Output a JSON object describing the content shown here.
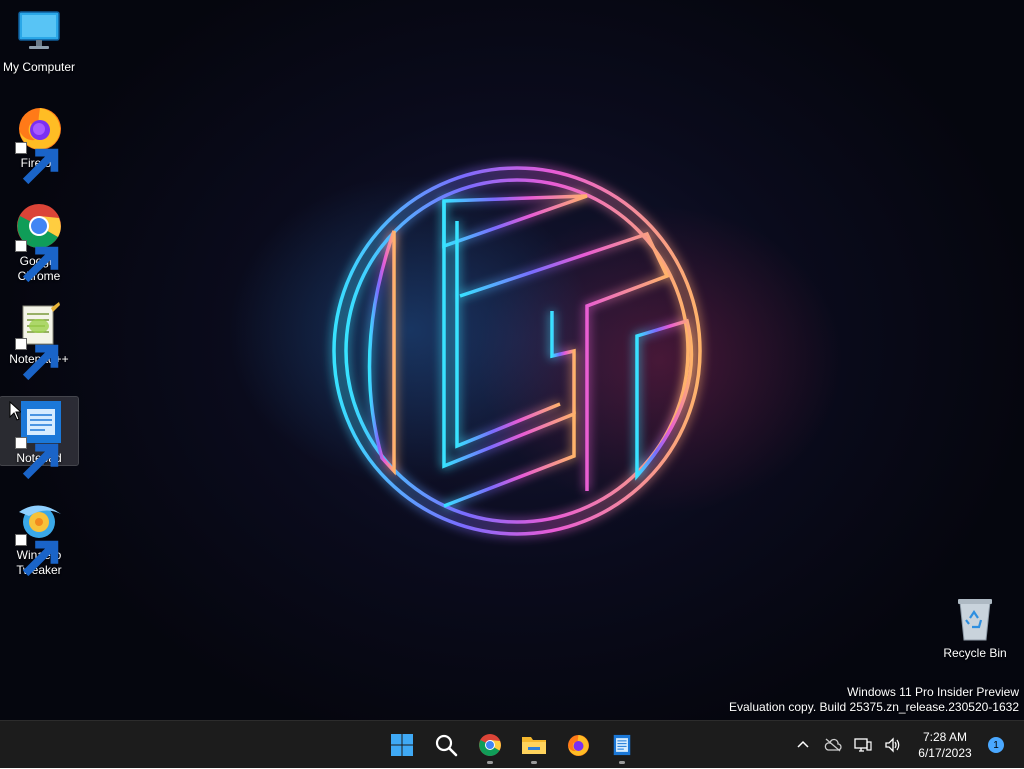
{
  "desktop": {
    "icons": [
      {
        "label": "My Computer"
      },
      {
        "label": "Firefox"
      },
      {
        "label": "Google Chrome"
      },
      {
        "label": "Notepad++"
      },
      {
        "label": "Notepad"
      },
      {
        "label": "Winaero Tweaker"
      },
      {
        "label": "Recycle Bin"
      }
    ],
    "selected_icon": "Notepad",
    "watermark": {
      "line1": "Windows 11 Pro Insider Preview",
      "line2": "Evaluation copy. Build 25375.zn_release.230520-1632"
    }
  },
  "taskbar": {
    "pinned": [
      {
        "name": "start-button",
        "icon": "windows-logo"
      },
      {
        "name": "search-button",
        "icon": "search-icon"
      },
      {
        "name": "chrome",
        "icon": "chrome-icon",
        "running": true
      },
      {
        "name": "file-explorer",
        "icon": "folder-icon",
        "running": true
      },
      {
        "name": "firefox",
        "icon": "firefox-icon",
        "running": false
      },
      {
        "name": "notepad",
        "icon": "notepad-icon",
        "running": true
      }
    ],
    "tray": {
      "icons": [
        "chevron-up-icon",
        "onedrive-offline-icon",
        "network-icon",
        "volume-icon"
      ],
      "time": "7:28 AM",
      "date": "6/17/2023",
      "notification_count": "1"
    }
  },
  "colors": {
    "taskbar_bg": "#1c1c1c",
    "accent": "#4aa8ff"
  }
}
